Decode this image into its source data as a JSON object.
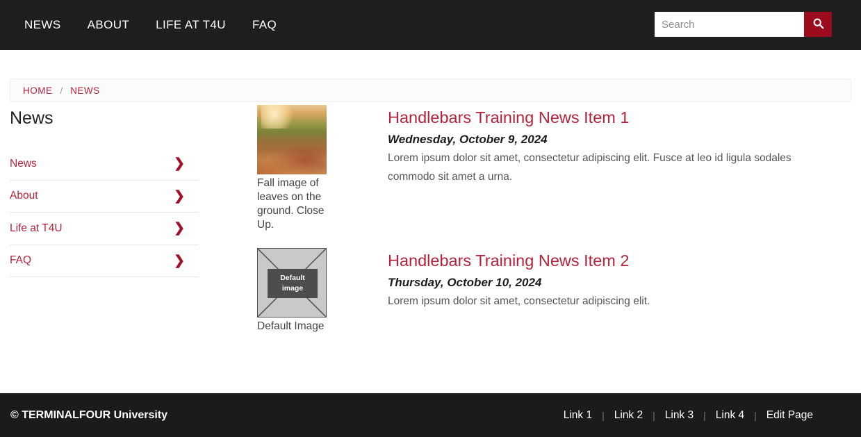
{
  "header": {
    "nav": [
      {
        "label": "NEWS"
      },
      {
        "label": "ABOUT"
      },
      {
        "label": "LIFE AT T4U"
      },
      {
        "label": "FAQ"
      }
    ],
    "search": {
      "placeholder": "Search",
      "value": "",
      "button_icon": "search-icon",
      "button_color": "#9d0b1f"
    },
    "background_color": "#1e1e1e"
  },
  "breadcrumb": {
    "items": [
      {
        "label": "HOME"
      },
      {
        "label": "NEWS"
      }
    ],
    "separator": "/"
  },
  "sidebar": {
    "title": "News",
    "items": [
      {
        "label": "News",
        "icon": "chevron-right-icon"
      },
      {
        "label": "About",
        "icon": "chevron-right-icon"
      },
      {
        "label": "Life at T4U",
        "icon": "chevron-right-icon"
      },
      {
        "label": "FAQ",
        "icon": "chevron-right-icon"
      }
    ]
  },
  "news": {
    "items": [
      {
        "title": "Handlebars Training News Item 1",
        "date": "Wednesday, October 9, 2024",
        "summary": "Lorem ipsum dolor sit amet, consectetur adipiscing elit. Fusce at leo id ligula sodales commodo sit amet a urna.",
        "image_caption": "Fall image of leaves on the ground. Close Up.",
        "image_type": "photo"
      },
      {
        "title": "Handlebars Training News Item 2",
        "date": "Thursday, October 10, 2024",
        "summary": "Lorem ipsum dolor sit amet, consectetur adipiscing elit.",
        "image_caption": "Default Image",
        "image_type": "placeholder",
        "placeholder_line1": "Default",
        "placeholder_line2": "image"
      }
    ]
  },
  "footer": {
    "copyright": "© TERMINALFOUR University",
    "links": [
      {
        "label": "Link 1"
      },
      {
        "label": "Link 2"
      },
      {
        "label": "Link 3"
      },
      {
        "label": "Link 4"
      },
      {
        "label": "Edit Page"
      }
    ],
    "separator": "|",
    "background_color": "#1b1b1b"
  },
  "theme": {
    "accent_red": "#b42339",
    "accent_dark_red": "#9d0b1f",
    "dark": "#1e1e1e"
  }
}
